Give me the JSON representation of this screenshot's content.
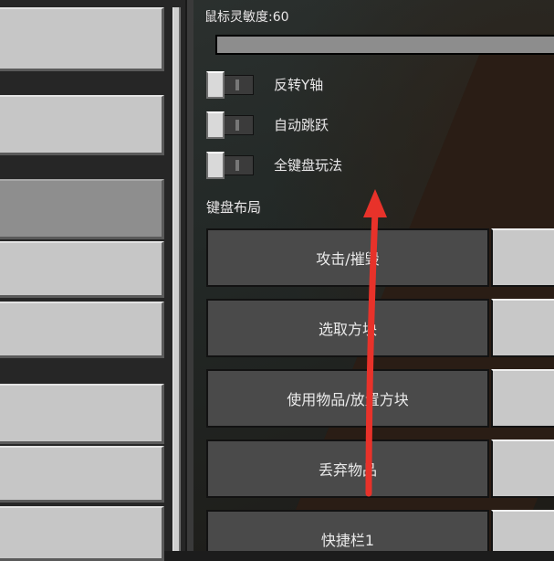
{
  "settings": {
    "mouse_sensitivity_label": "鼠标灵敏度:60",
    "mouse_sensitivity_value": 60,
    "toggles": [
      {
        "label": "反转Y轴",
        "on": false
      },
      {
        "label": "自动跳跃",
        "on": false
      },
      {
        "label": "全键盘玩法",
        "on": false
      }
    ],
    "keyboard_layout_heading": "键盘布局",
    "key_actions": [
      {
        "label": "攻击/摧毁"
      },
      {
        "label": "选取方块"
      },
      {
        "label": "使用物品/放置方块"
      },
      {
        "label": "丢弃物品"
      },
      {
        "label": "快捷栏1"
      }
    ]
  },
  "colors": {
    "annotation_arrow": "#e8322a",
    "button_face": "#c6c6c6",
    "button_selected": "#8e8e8e",
    "dark_button": "#4a4a4a"
  }
}
